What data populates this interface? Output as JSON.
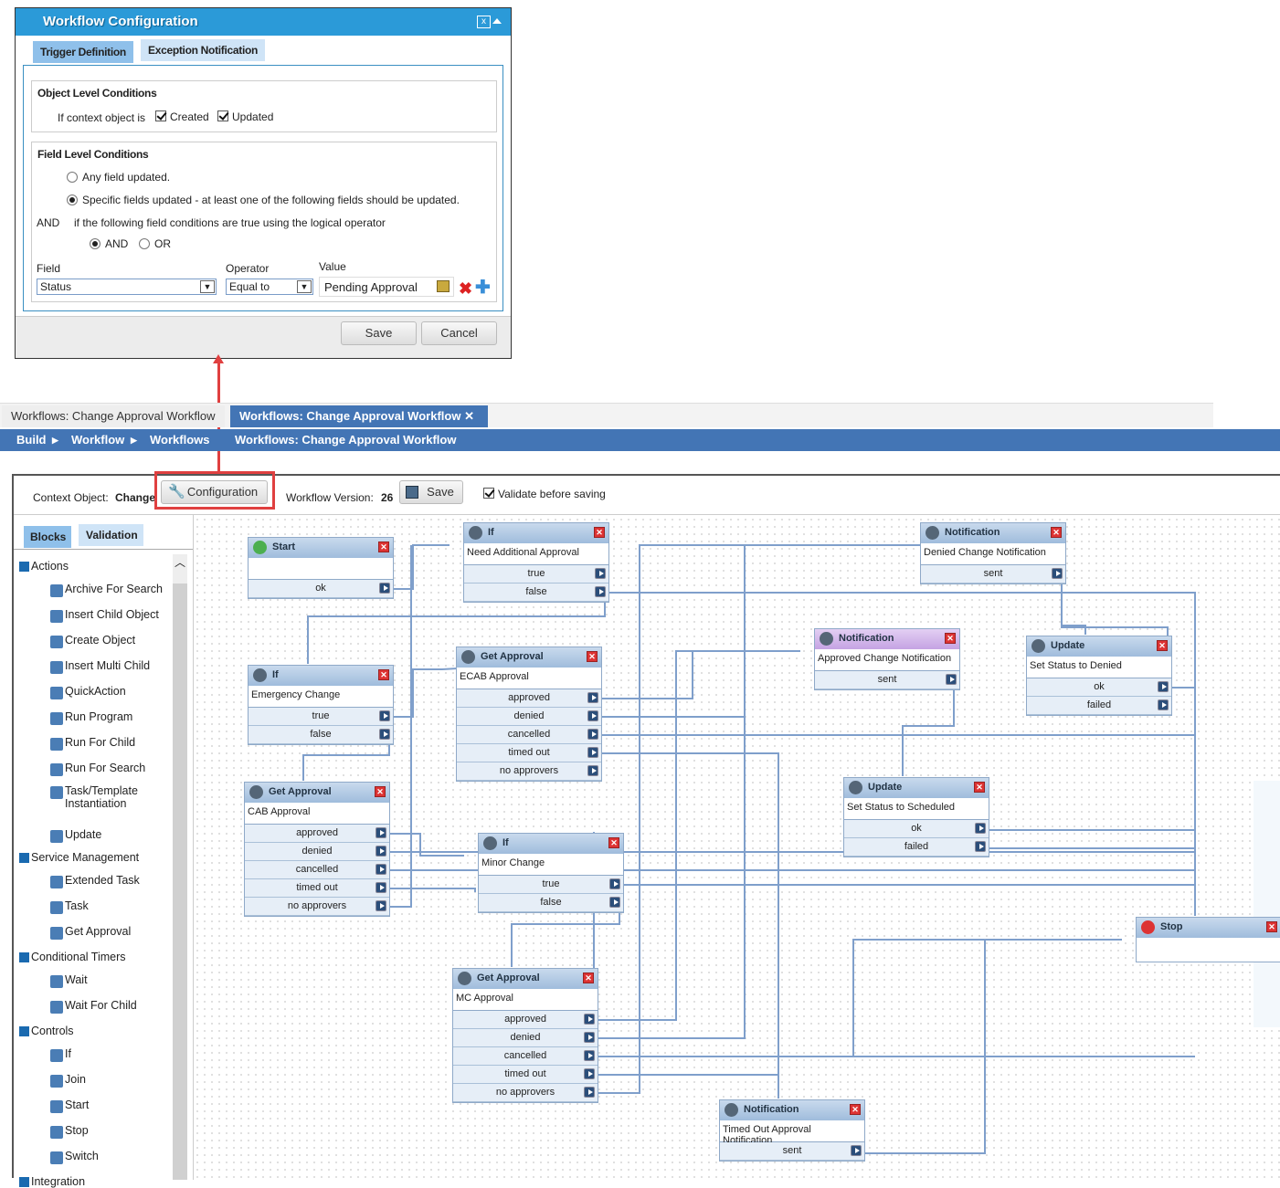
{
  "dialog": {
    "title": "Workflow Configuration",
    "close_icon": "close-window-icon",
    "tabs": [
      "Trigger Definition",
      "Exception Notification"
    ],
    "object_level": {
      "heading": "Object Level Conditions",
      "prefix": "If context object is",
      "created": {
        "label": "Created",
        "checked": true
      },
      "updated": {
        "label": "Updated",
        "checked": true
      }
    },
    "field_level": {
      "heading": "Field Level Conditions",
      "any_field": {
        "label": "Any field updated.",
        "selected": false
      },
      "specific": {
        "label": "Specific fields updated - at least one of the following fields should be updated.",
        "selected": true
      },
      "and_label": "AND",
      "operator_text": "if the following field conditions are true using the logical operator",
      "op_and": {
        "label": "AND",
        "selected": true
      },
      "op_or": {
        "label": "OR",
        "selected": false
      },
      "field_label": "Field",
      "operator_label": "Operator",
      "value_label": "Value",
      "field_value": "Status",
      "operator_value": "Equal to",
      "value_value": "Pending Approval"
    },
    "save": "Save",
    "cancel": "Cancel"
  },
  "tabs": [
    {
      "label": "Workflows: Change Approval Workflow",
      "active": false
    },
    {
      "label": "Workflows: Change Approval Workflow",
      "active": true
    }
  ],
  "breadcrumb": [
    "Build",
    "Workflow",
    "Workflows",
    "Workflows: Change Approval Workflow"
  ],
  "toolbar": {
    "context_label": "Context Object:",
    "context_value": "Change",
    "configuration": "Configuration",
    "version_label": "Workflow Version:",
    "version_value": "26",
    "save": "Save",
    "validate": {
      "label": "Validate before saving",
      "checked": true
    }
  },
  "sidebar": {
    "tabs": [
      "Blocks",
      "Validation"
    ],
    "groups": [
      {
        "label": "Actions",
        "items": [
          "Archive For Search",
          "Insert Child Object",
          "Create Object",
          "Insert Multi Child",
          "QuickAction",
          "Run Program",
          "Run For Child",
          "Run For Search",
          "Task/Template Instantiation",
          "Update"
        ]
      },
      {
        "label": "Service Management",
        "items": [
          "Extended Task",
          "Task",
          "Get Approval"
        ]
      },
      {
        "label": "Conditional Timers",
        "items": [
          "Wait",
          "Wait For Child"
        ]
      },
      {
        "label": "Controls",
        "items": [
          "If",
          "Join",
          "Start",
          "Stop",
          "Switch"
        ]
      },
      {
        "label": "Integration",
        "items": []
      }
    ]
  },
  "canvas": {
    "connector_color": "#7f9fcb",
    "nodes": [
      {
        "type": "Start",
        "icon": "start-icon",
        "desc": "",
        "outcomes": [
          "ok"
        ]
      },
      {
        "type": "If",
        "icon": "if-icon",
        "desc": "Need Additional Approval",
        "outcomes": [
          "true",
          "false"
        ]
      },
      {
        "type": "Notification",
        "icon": "notification-icon",
        "desc": "Denied Change Notification",
        "outcomes": [
          "sent"
        ]
      },
      {
        "type": "If",
        "icon": "if-icon",
        "desc": "Emergency Change",
        "outcomes": [
          "true",
          "false"
        ]
      },
      {
        "type": "Get Approval",
        "icon": "thumbs-up-icon",
        "desc": "ECAB Approval",
        "outcomes": [
          "approved",
          "denied",
          "cancelled",
          "timed out",
          "no approvers"
        ]
      },
      {
        "type": "Notification",
        "icon": "notification-icon",
        "desc": "Approved Change Notification",
        "outcomes": [
          "sent"
        ],
        "highlight": "#c5a3e3"
      },
      {
        "type": "Update",
        "icon": "pencil-icon",
        "desc": "Set Status to Denied",
        "outcomes": [
          "ok",
          "failed"
        ]
      },
      {
        "type": "Get Approval",
        "icon": "thumbs-up-icon",
        "desc": "CAB Approval",
        "outcomes": [
          "approved",
          "denied",
          "cancelled",
          "timed out",
          "no approvers"
        ]
      },
      {
        "type": "If",
        "icon": "if-icon",
        "desc": "Minor Change",
        "outcomes": [
          "true",
          "false"
        ]
      },
      {
        "type": "Update",
        "icon": "pencil-icon",
        "desc": "Set Status to Scheduled",
        "outcomes": [
          "ok",
          "failed"
        ]
      },
      {
        "type": "Stop",
        "icon": "stop-icon",
        "desc": "",
        "outcomes": []
      },
      {
        "type": "Get Approval",
        "icon": "thumbs-up-icon",
        "desc": "MC Approval",
        "outcomes": [
          "approved",
          "denied",
          "cancelled",
          "timed out",
          "no approvers"
        ]
      },
      {
        "type": "Notification",
        "icon": "notification-icon",
        "desc": "Timed Out Approval Notification",
        "outcomes": [
          "sent"
        ]
      }
    ]
  }
}
